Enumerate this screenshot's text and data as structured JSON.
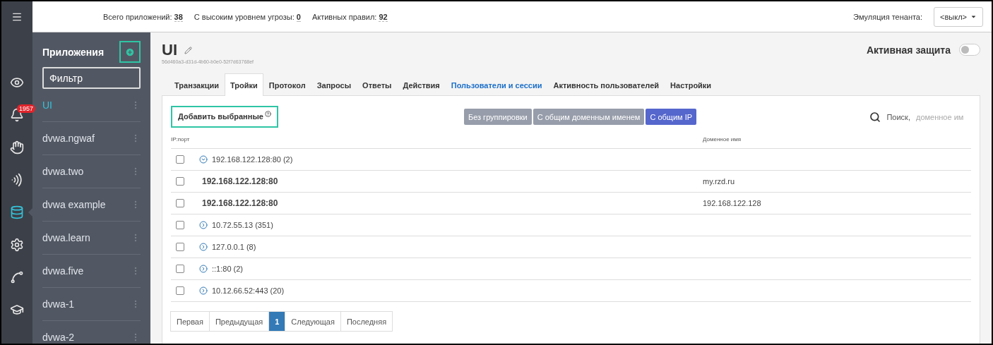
{
  "rail": [
    {
      "kind": "eye",
      "selected": false
    },
    {
      "kind": "bell",
      "selected": false,
      "badge": "1957"
    },
    {
      "kind": "hand",
      "selected": false
    },
    {
      "kind": "signal",
      "selected": false
    },
    {
      "kind": "database",
      "selected": true
    },
    {
      "kind": "gear",
      "selected": false
    },
    {
      "kind": "chart",
      "selected": false
    },
    {
      "kind": "cap",
      "selected": false
    }
  ],
  "stats": [
    {
      "label": "Всего приложений:",
      "value": "38"
    },
    {
      "label": "С высоким уровнем угрозы:",
      "value": "0"
    },
    {
      "label": "Активных правил:",
      "value": "92"
    }
  ],
  "tenant": {
    "label": "Эмуляция тенанта:",
    "value": "<выкл>"
  },
  "sidebar": {
    "title": "Приложения",
    "filter": {
      "value": "Фильтр"
    },
    "items": [
      {
        "label": "UI",
        "selected": true
      },
      {
        "label": "dvwa.ngwaf",
        "selected": false
      },
      {
        "label": "dvwa.two",
        "selected": false
      },
      {
        "label": "dvwa example",
        "selected": false
      },
      {
        "label": "dvwa.learn",
        "selected": false
      },
      {
        "label": "dvwa.five",
        "selected": false
      },
      {
        "label": "dvwa-1",
        "selected": false
      },
      {
        "label": "dvwa-2",
        "selected": false
      }
    ]
  },
  "app": {
    "title": "UI",
    "id": "56d460a3-d31d-4b60-b0e0-52f7d63768ef",
    "protection": {
      "label": "Активная защита",
      "on": false
    }
  },
  "tabs": [
    {
      "label": "Транзакции",
      "selected": false,
      "kind": "tab"
    },
    {
      "label": "Тройки",
      "selected": true,
      "kind": "tab"
    },
    {
      "label": "Протокол",
      "selected": false,
      "kind": "tab"
    },
    {
      "label": "Запросы",
      "selected": false,
      "kind": "tab"
    },
    {
      "label": "Ответы",
      "selected": false,
      "kind": "tab"
    },
    {
      "label": "Действия",
      "selected": false,
      "kind": "tab"
    },
    {
      "label": "Пользователи и сессии",
      "selected": false,
      "kind": "link"
    },
    {
      "label": "Активность пользователей",
      "selected": false,
      "kind": "tab"
    },
    {
      "label": "Настройки",
      "selected": false,
      "kind": "tab"
    }
  ],
  "add_button": {
    "label": "Добавить выбранные"
  },
  "grouping": [
    {
      "label": "Без группировки",
      "selected": false
    },
    {
      "label": "С общим доменным именем",
      "selected": false
    },
    {
      "label": "С общим IP",
      "selected": true
    }
  ],
  "search": {
    "label": "Поиск,",
    "placeholder": "доменное им"
  },
  "table": {
    "columns": [
      "IP:порт",
      "Доменное имя"
    ],
    "rows": [
      {
        "kind": "group",
        "ip": "192.168.122.128:80 (2)",
        "expanded": true,
        "checked": false
      },
      {
        "kind": "item",
        "ip": "192.168.122.128:80",
        "domain": "my.rzd.ru",
        "checked": false
      },
      {
        "kind": "item",
        "ip": "192.168.122.128:80",
        "domain": "192.168.122.128",
        "checked": false
      },
      {
        "kind": "group",
        "ip": "10.72.55.13 (351)",
        "expanded": false,
        "checked": false
      },
      {
        "kind": "group",
        "ip": "127.0.0.1 (8)",
        "expanded": false,
        "checked": false
      },
      {
        "kind": "group",
        "ip": "::1:80 (2)",
        "expanded": false,
        "checked": false
      },
      {
        "kind": "group",
        "ip": "10.12.66.52:443 (20)",
        "expanded": false,
        "checked": false
      }
    ]
  },
  "pagination": [
    {
      "label": "Первая",
      "selected": false
    },
    {
      "label": "Предыдущая",
      "selected": false
    },
    {
      "label": "1",
      "selected": true
    },
    {
      "label": "Следующая",
      "selected": false
    },
    {
      "label": "Последняя",
      "selected": false
    }
  ]
}
